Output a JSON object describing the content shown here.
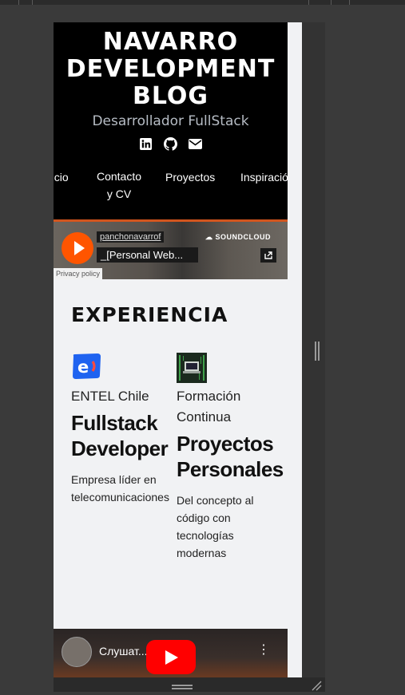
{
  "header": {
    "title_lines": [
      "NAVARRO",
      "DEVELOPMENT",
      "BLOG"
    ],
    "subtitle": "Desarrollador FullStack",
    "social": [
      "linkedin-icon",
      "github-icon",
      "email-icon"
    ]
  },
  "nav": {
    "items": [
      "Inicio",
      "Contacto y CV",
      "Proyectos",
      "Inspiración"
    ]
  },
  "soundcloud": {
    "user": "panchonavarrof",
    "track": "_[Personal Web...",
    "brand": "SOUNDCLOUD",
    "privacy": "Privacy policy"
  },
  "experience": {
    "title": "EXPERIENCIA",
    "items": [
      {
        "company": "ENTEL Chile",
        "role": "Fullstack Developer",
        "description": "Empresa líder en telecomunicaciones"
      },
      {
        "company": "Formación Continua",
        "role": "Proyectos Personales",
        "description": "Del concepto al código con tecnologías modernas"
      }
    ]
  },
  "video": {
    "title": "Слушат... у Ого..."
  },
  "colors": {
    "accent": "#d2551e",
    "soundcloud": "#ff5500",
    "youtube": "#ff0000",
    "entel": "#1f63f0"
  }
}
